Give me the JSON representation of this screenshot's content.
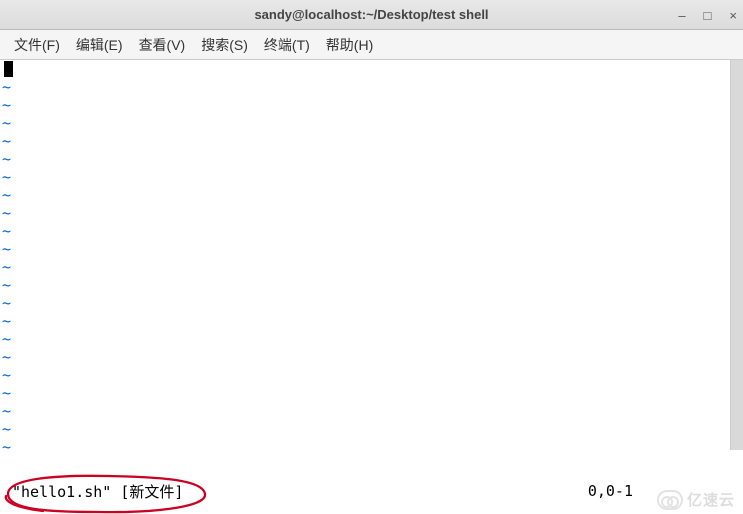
{
  "window": {
    "title": "sandy@localhost:~/Desktop/test shell"
  },
  "menu": {
    "file": "文件(F)",
    "edit": "编辑(E)",
    "view": "查看(V)",
    "search": "搜索(S)",
    "terminal": "终端(T)",
    "help": "帮助(H)"
  },
  "editor": {
    "tilde": "~",
    "tilde_count": 21,
    "status_file": "\"hello1.sh\" [新文件]",
    "status_position": "0,0-1"
  },
  "watermark": {
    "text": "亿速云"
  }
}
